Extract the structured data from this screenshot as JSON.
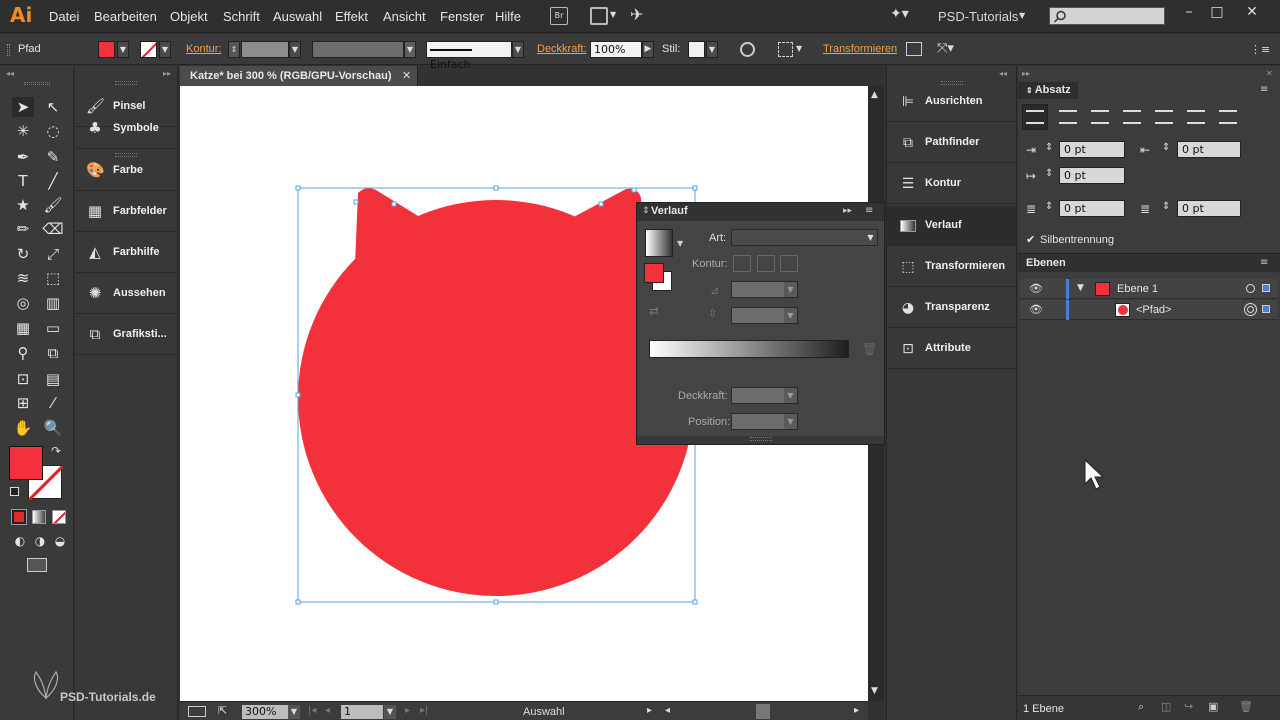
{
  "menubar": {
    "logo": "Ai",
    "items": [
      "Datei",
      "Bearbeiten",
      "Objekt",
      "Schrift",
      "Auswahl",
      "Effekt",
      "Ansicht",
      "Fenster",
      "Hilfe"
    ],
    "bridge_label": "Br",
    "workspace": "PSD-Tutorials"
  },
  "controlbar": {
    "selection_type": "Pfad",
    "kontur_label": "Kontur:",
    "stroke_profile": "Einfach",
    "deckkraft_label": "Deckkraft:",
    "deckkraft_value": "100%",
    "stil_label": "Stil:",
    "transformieren_label": "Transformieren"
  },
  "colors": {
    "accent_orange": "#f08a24",
    "fill_red": "#f3313a",
    "selection_blue": "#5aa0e6",
    "canvas": "#ffffff"
  },
  "left_dock": {
    "items": [
      {
        "label": "Pinsel",
        "icon": "brush-icon"
      },
      {
        "label": "Symbole",
        "icon": "symbols-icon"
      },
      {
        "label": "Farbe",
        "icon": "palette-icon"
      },
      {
        "label": "Farbfelder",
        "icon": "swatches-icon"
      },
      {
        "label": "Farbhilfe",
        "icon": "color-guide-icon"
      },
      {
        "label": "Aussehen",
        "icon": "appearance-icon"
      },
      {
        "label": "Grafiksti...",
        "icon": "graphic-styles-icon"
      }
    ]
  },
  "document": {
    "tab_title": "Katze* bei 300 % (RGB/GPU-Vorschau)",
    "close_glyph": "✕"
  },
  "statusbar": {
    "zoom": "300%",
    "artboard": "1",
    "tool_name": "Auswahl"
  },
  "verlauf": {
    "title": "Verlauf",
    "art_label": "Art:",
    "kontur_label": "Kontur:",
    "deckkraft_label": "Deckkraft:",
    "position_label": "Position:"
  },
  "right_dock": {
    "items": [
      {
        "label": "Ausrichten",
        "icon": "align-icon"
      },
      {
        "label": "Pathfinder",
        "icon": "pathfinder-icon"
      },
      {
        "label": "Kontur",
        "icon": "stroke-icon"
      },
      {
        "label": "Verlauf",
        "icon": "gradient-icon"
      },
      {
        "label": "Transformieren",
        "icon": "transform-icon"
      },
      {
        "label": "Transparenz",
        "icon": "transparency-icon"
      },
      {
        "label": "Attribute",
        "icon": "attributes-icon"
      }
    ]
  },
  "absatz": {
    "title": "Absatz",
    "indent_left": "0 pt",
    "indent_right": "0 pt",
    "indent_first": "0 pt",
    "space_before": "0 pt",
    "space_after": "0 pt",
    "hyphenation_label": "Silbentrennung"
  },
  "ebenen": {
    "title": "Ebenen",
    "layer_name": "Ebene 1",
    "sublayer_name": "<Pfad>",
    "footer": "1 Ebene"
  },
  "watermark": "PSD-Tutorials.de"
}
